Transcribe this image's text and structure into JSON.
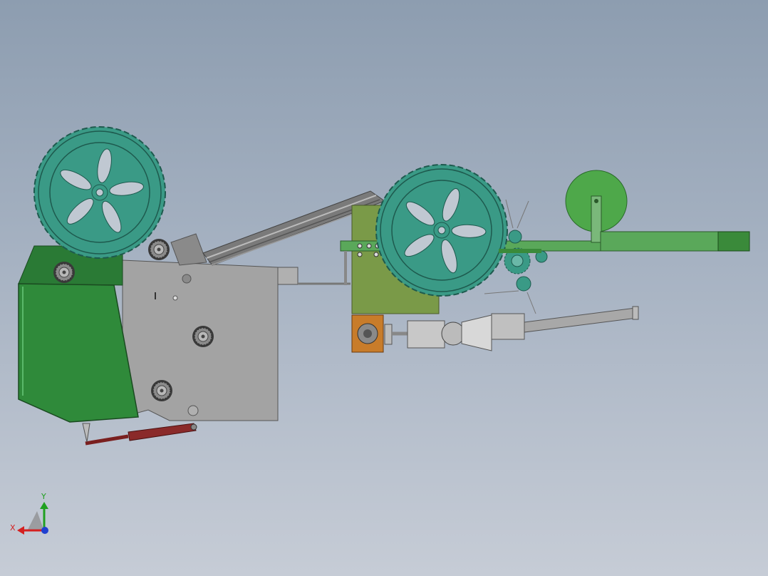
{
  "colors": {
    "background_top": "#8d9db0",
    "background_bottom": "#c6ccd6",
    "wheel_teal": "#3a9a86",
    "frame_gray": "#a3a3a3",
    "hopper_green": "#2f8a3a",
    "bracket_olive": "#7a9a48",
    "arm_green": "#5aa85a",
    "disc_green": "#4ea84a",
    "motor_orange": "#c87c2a",
    "cylinder_red": "#8a2a2a",
    "axis_x_red": "#d42020",
    "axis_y_green": "#20a020",
    "axis_z_blue": "#2040d0"
  },
  "triad": {
    "x_label": "X",
    "y_label": "Y"
  }
}
